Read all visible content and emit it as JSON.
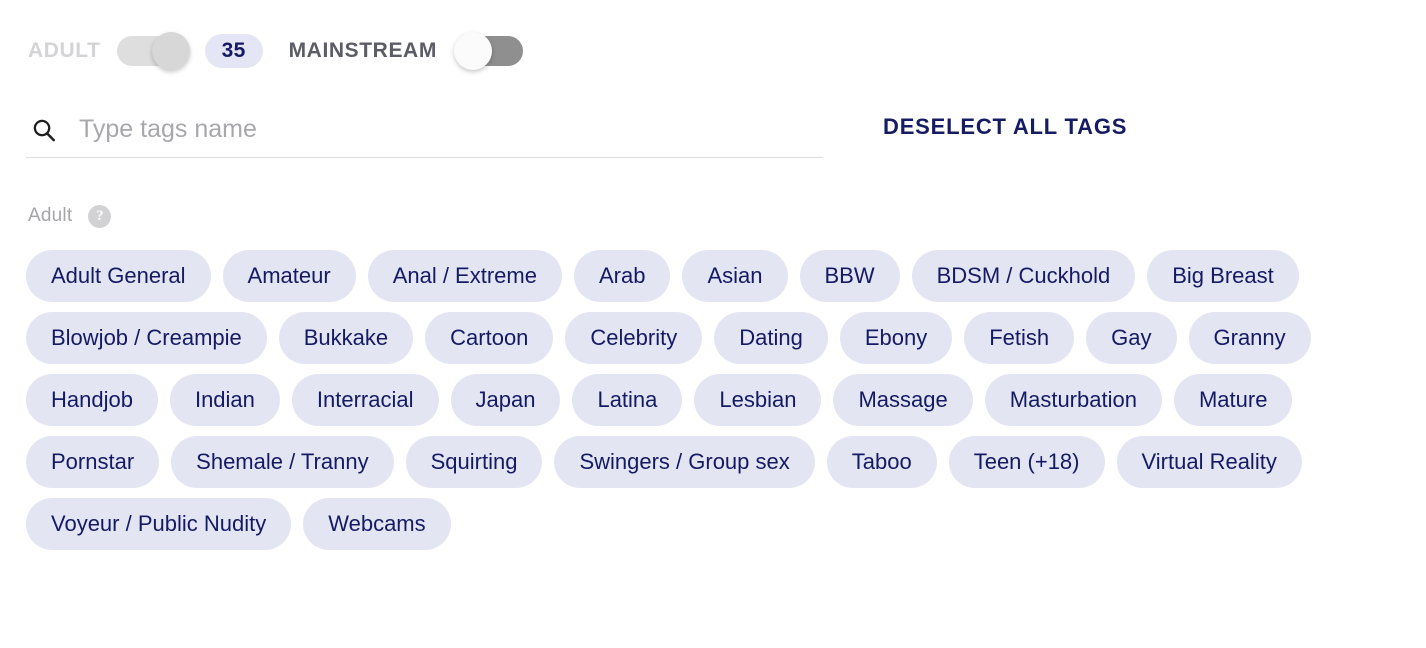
{
  "header": {
    "adult_label": "ADULT",
    "mainstream_label": "MAINSTREAM",
    "selected_count": "35",
    "adult_toggle_state": "on-right",
    "mainstream_toggle_state": "off-left"
  },
  "search": {
    "placeholder": "Type tags name",
    "value": "",
    "icon": "search-icon"
  },
  "actions": {
    "deselect_all_label": "DESELECT ALL TAGS"
  },
  "section": {
    "title": "Adult",
    "help_glyph": "?"
  },
  "colors": {
    "chip_bg": "#e4e5f3",
    "chip_text": "#141a63",
    "badge_bg": "#e5e6f5",
    "badge_text": "#141a63",
    "deselect_text": "#161c63",
    "adult_label": "#d4d4d6",
    "mainstream_label": "#5c5c66",
    "section_title": "#a6a6aa",
    "help_bg": "#d2d2d4",
    "search_placeholder": "#a8a8ac",
    "search_underline": "#dcdcdc",
    "switch_adult_track": "#dedede",
    "switch_adult_knob": "#d7d7d7",
    "switch_mainstream_track": "#8f8f8f",
    "switch_mainstream_knob": "#fbfbfb"
  },
  "tags": [
    "Adult General",
    "Amateur",
    "Anal / Extreme",
    "Arab",
    "Asian",
    "BBW",
    "BDSM / Cuckhold",
    "Big Breast",
    "Blowjob / Creampie",
    "Bukkake",
    "Cartoon",
    "Celebrity",
    "Dating",
    "Ebony",
    "Fetish",
    "Gay",
    "Granny",
    "Handjob",
    "Indian",
    "Interracial",
    "Japan",
    "Latina",
    "Lesbian",
    "Massage",
    "Masturbation",
    "Mature",
    "Pornstar",
    "Shemale / Tranny",
    "Squirting",
    "Swingers / Group sex",
    "Taboo",
    "Teen (+18)",
    "Virtual Reality",
    "Voyeur / Public Nudity",
    "Webcams"
  ]
}
